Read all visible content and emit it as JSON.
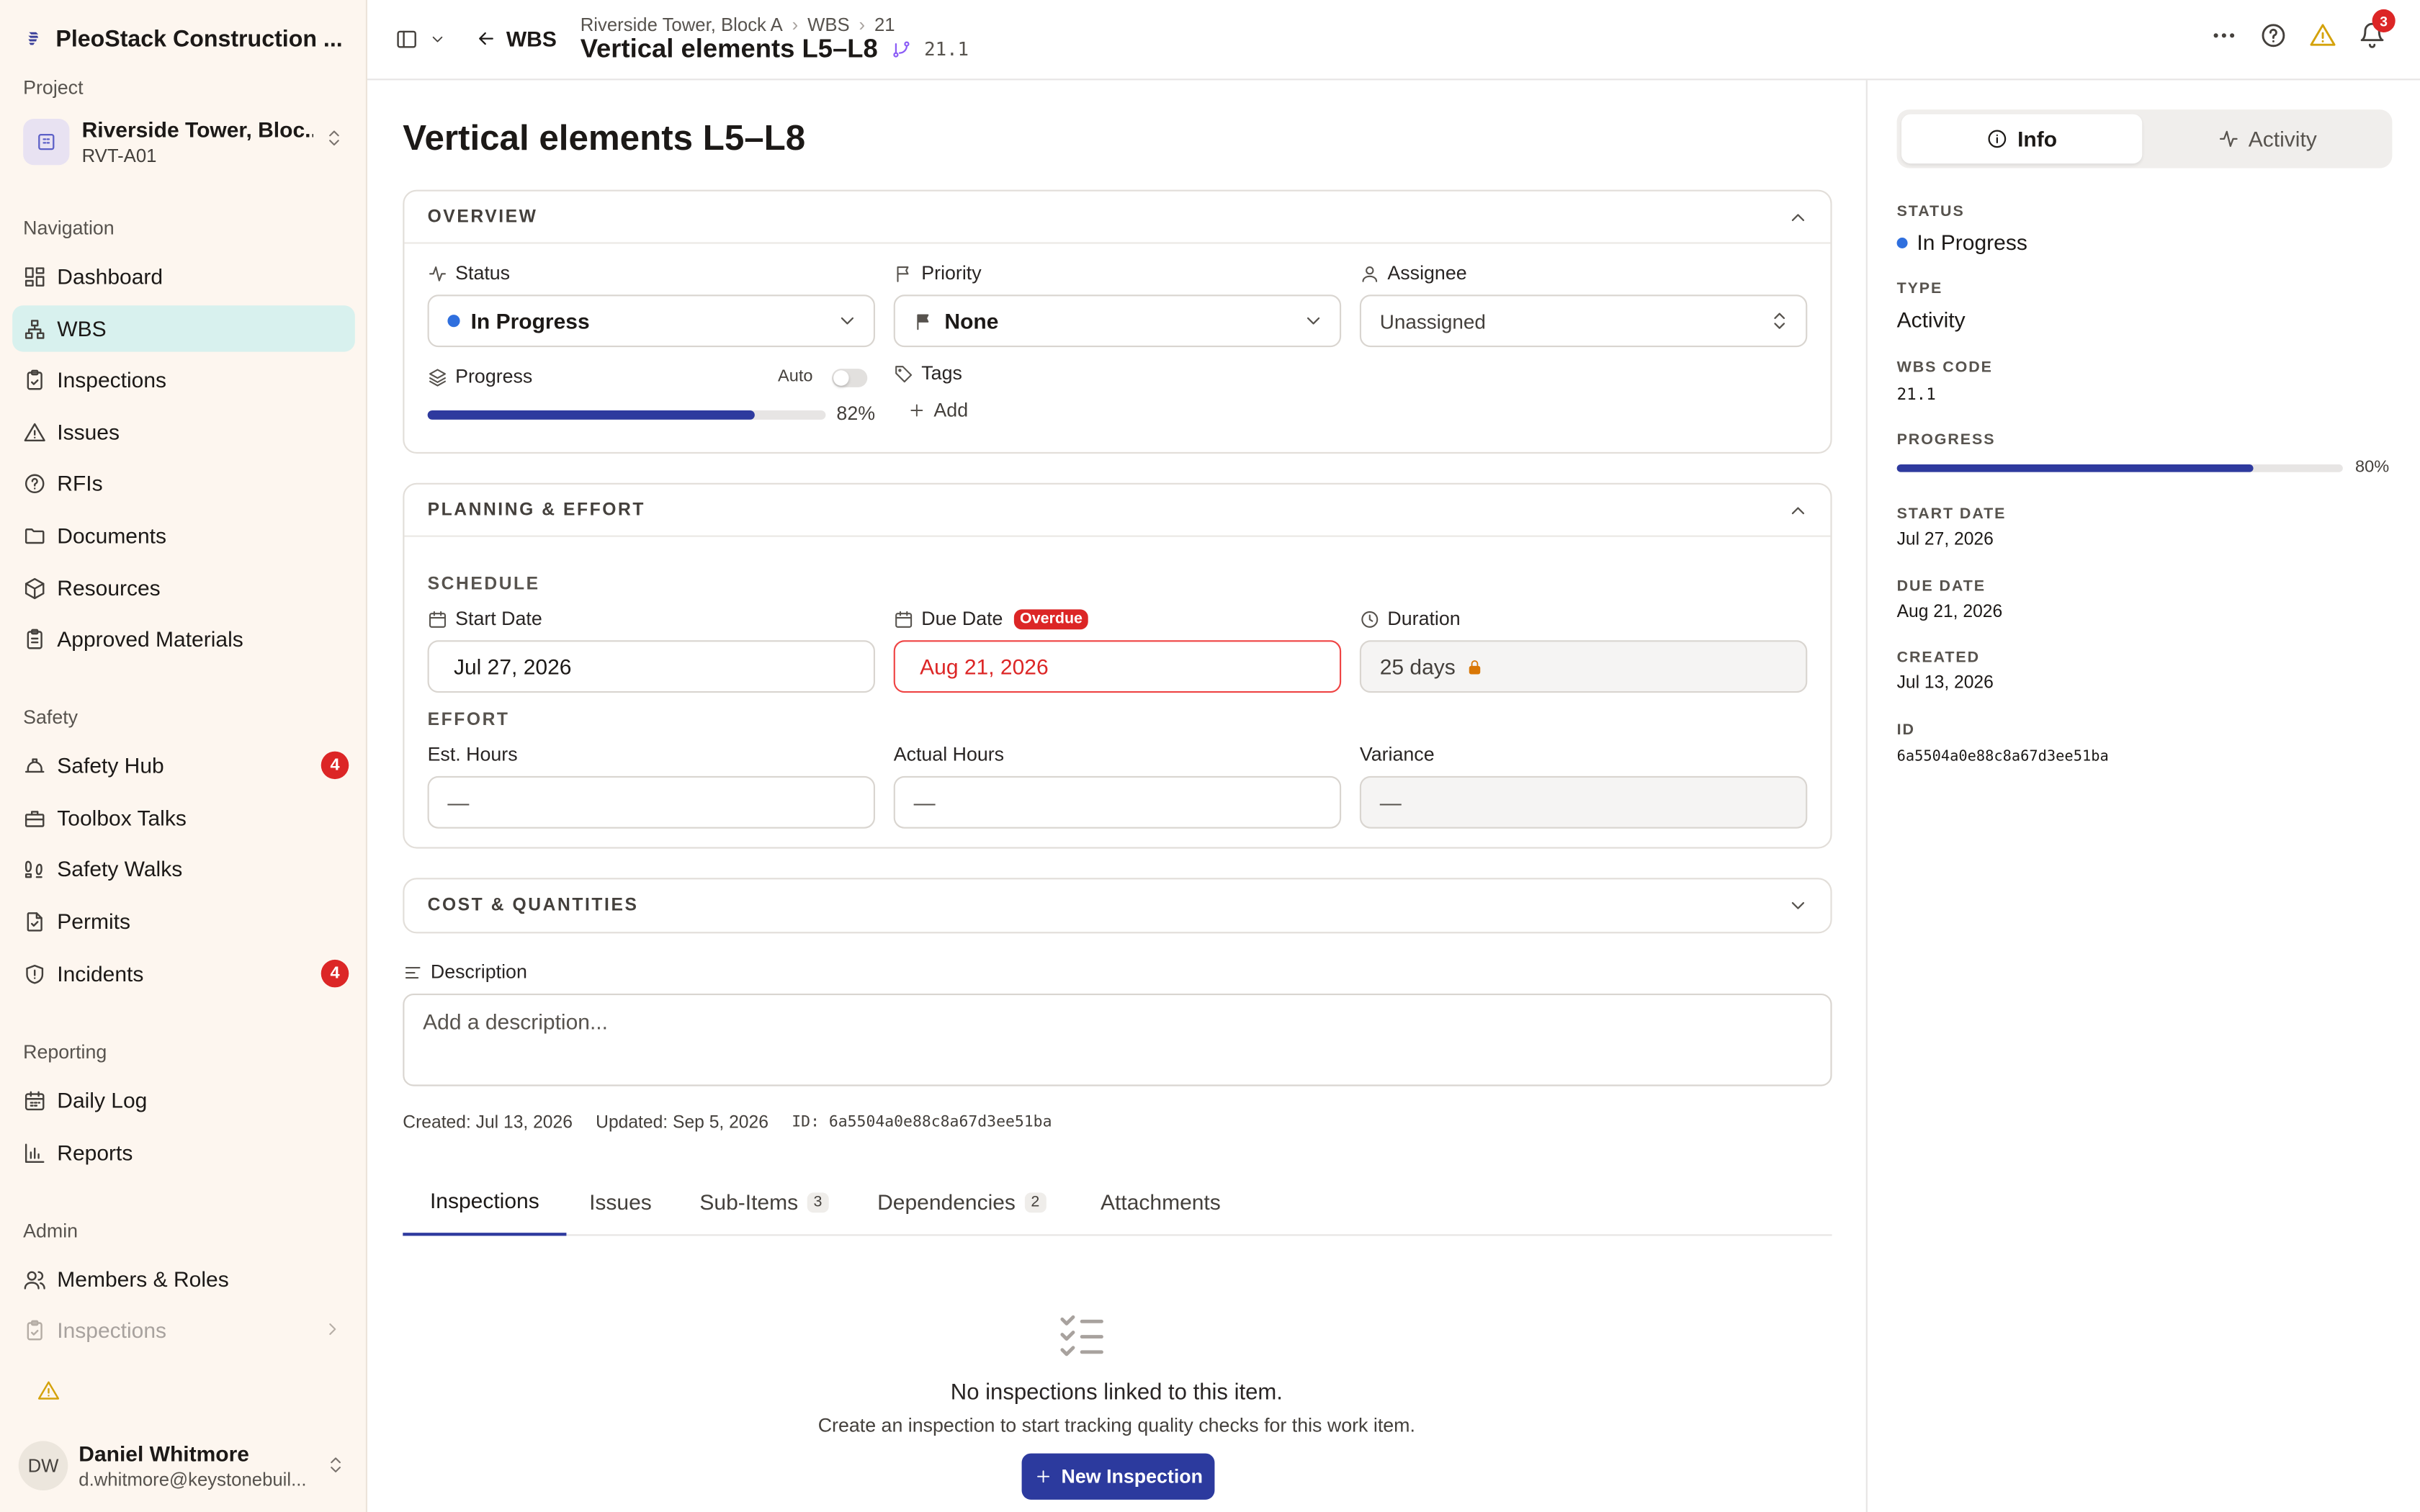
{
  "org": {
    "name": "PleoStack Construction ..."
  },
  "project": {
    "section_label": "Project",
    "name": "Riverside Tower, Bloc...",
    "code": "RVT-A01"
  },
  "sidebar": {
    "sections": [
      {
        "label": "Navigation",
        "items": [
          {
            "label": "Dashboard",
            "icon": "dashboard-icon"
          },
          {
            "label": "WBS",
            "icon": "hierarchy-icon",
            "active": true
          },
          {
            "label": "Inspections",
            "icon": "clipboard-check-icon"
          },
          {
            "label": "Issues",
            "icon": "warning-triangle-icon"
          },
          {
            "label": "RFIs",
            "icon": "help-circle-icon"
          },
          {
            "label": "Documents",
            "icon": "folder-icon"
          },
          {
            "label": "Resources",
            "icon": "package-icon"
          },
          {
            "label": "Approved Materials",
            "icon": "clipboard-list-icon"
          }
        ]
      },
      {
        "label": "Safety",
        "items": [
          {
            "label": "Safety Hub",
            "icon": "hard-hat-icon",
            "badge": "4"
          },
          {
            "label": "Toolbox Talks",
            "icon": "toolbox-icon"
          },
          {
            "label": "Safety Walks",
            "icon": "footprints-icon"
          },
          {
            "label": "Permits",
            "icon": "file-check-icon"
          },
          {
            "label": "Incidents",
            "icon": "shield-alert-icon",
            "badge": "4"
          }
        ]
      },
      {
        "label": "Reporting",
        "items": [
          {
            "label": "Daily Log",
            "icon": "calendar-icon"
          },
          {
            "label": "Reports",
            "icon": "bar-chart-icon"
          }
        ]
      },
      {
        "label": "Admin",
        "items": [
          {
            "label": "Members & Roles",
            "icon": "users-icon"
          },
          {
            "label": "Inspections",
            "icon": "clipboard-check-icon"
          }
        ]
      }
    ]
  },
  "user": {
    "initials": "DW",
    "name": "Daniel Whitmore",
    "email": "d.whitmore@keystonebuil..."
  },
  "header": {
    "back_label": "WBS",
    "breadcrumbs": [
      "Riverside Tower, Block A",
      "WBS",
      "21"
    ],
    "title": "Vertical elements L5–L8",
    "code": "21.1",
    "notification_count": "3"
  },
  "page": {
    "title": "Vertical elements L5–L8"
  },
  "overview": {
    "heading": "OVERVIEW",
    "status": {
      "label": "Status",
      "value": "In Progress",
      "color": "#2f6fde"
    },
    "priority": {
      "label": "Priority",
      "value": "None"
    },
    "assignee": {
      "label": "Assignee",
      "value": "Unassigned"
    },
    "progress": {
      "label": "Progress",
      "auto_label": "Auto",
      "value": 0.82,
      "text": "82%"
    },
    "tags": {
      "label": "Tags",
      "add_label": "Add"
    }
  },
  "planning": {
    "heading": "PLANNING & EFFORT",
    "schedule_label": "SCHEDULE",
    "start": {
      "label": "Start Date",
      "value": "Jul 27, 2026"
    },
    "due": {
      "label": "Due Date",
      "badge": "Overdue",
      "value": "Aug 21, 2026"
    },
    "duration": {
      "label": "Duration",
      "value": "25 days"
    },
    "effort_label": "EFFORT",
    "est": {
      "label": "Est. Hours",
      "value": "—"
    },
    "actual": {
      "label": "Actual Hours",
      "value": "—"
    },
    "variance": {
      "label": "Variance",
      "value": "—"
    }
  },
  "cost": {
    "heading": "COST & QUANTITIES"
  },
  "description": {
    "label": "Description",
    "placeholder": "Add a description..."
  },
  "meta": {
    "created": "Created: Jul 13, 2026",
    "updated": "Updated: Sep 5, 2026",
    "id_label": "ID:",
    "id": "6a5504a0e88c8a67d3ee51ba"
  },
  "tabs": [
    {
      "label": "Inspections",
      "active": true
    },
    {
      "label": "Issues"
    },
    {
      "label": "Sub-Items",
      "count": "3"
    },
    {
      "label": "Dependencies",
      "count": "2"
    },
    {
      "label": "Attachments"
    }
  ],
  "empty": {
    "title": "No inspections linked to this item.",
    "subtitle": "Create an inspection to start tracking quality checks for this work item.",
    "button": "New Inspection"
  },
  "panel": {
    "tabs": [
      "Info",
      "Activity"
    ],
    "status_label": "STATUS",
    "status": "In Progress",
    "type_label": "TYPE",
    "type": "Activity",
    "wbs_label": "WBS CODE",
    "wbs": "21.1",
    "progress_label": "PROGRESS",
    "progress": 0.8,
    "progress_text": "80%",
    "start_label": "START DATE",
    "start": "Jul 27, 2026",
    "due_label": "DUE DATE",
    "due": "Aug 21, 2026",
    "created_label": "CREATED",
    "created": "Jul 13, 2026",
    "id_label": "ID",
    "id": "6a5504a0e88c8a67d3ee51ba"
  },
  "colors": {
    "accent": "#2e3a9e",
    "active_nav": "#d8f1ee",
    "danger": "#dc2626",
    "sidebar_bg": "#fdf6ef"
  }
}
